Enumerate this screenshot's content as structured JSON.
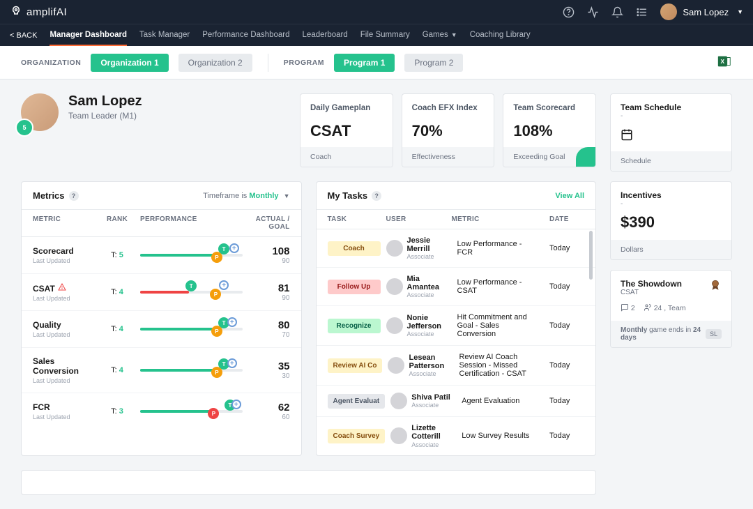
{
  "brand": "amplifAI",
  "user_top": "Sam Lopez",
  "nav": {
    "back": "< BACK",
    "items": [
      "Manager Dashboard",
      "Task Manager",
      "Performance Dashboard",
      "Leaderboard",
      "File Summary",
      "Games",
      "Coaching Library"
    ],
    "active": 0
  },
  "filters": {
    "org_label": "ORGANIZATION",
    "orgs": [
      "Organization 1",
      "Organization 2"
    ],
    "org_active": 0,
    "prog_label": "PROGRAM",
    "progs": [
      "Program 1",
      "Program 2"
    ],
    "prog_active": 0
  },
  "hero": {
    "name": "Sam Lopez",
    "role": "Team Leader (M1)",
    "badge": "5"
  },
  "kpis": [
    {
      "title": "Daily Gameplan",
      "value": "CSAT",
      "foot": "Coach"
    },
    {
      "title": "Coach EFX Index",
      "value": "70%",
      "foot": "Effectiveness"
    },
    {
      "title": "Team Scorecard",
      "value": "108%",
      "foot": "Exceeding Goal",
      "accent": true
    }
  ],
  "metrics": {
    "title": "Metrics",
    "timeframe_prefix": "Timeframe is ",
    "timeframe": "Monthly",
    "headers": [
      "METRIC",
      "RANK",
      "PERFORMANCE",
      "ACTUAL / GOAL"
    ],
    "rows": [
      {
        "name": "Scorecard",
        "sub": "Last Updated",
        "rank": "5",
        "actual": "108",
        "goal": "90",
        "warn": false,
        "t": 82,
        "p": 75,
        "plus": 92,
        "fill": 72,
        "color": "#25c28d",
        "p_red": false
      },
      {
        "name": "CSAT",
        "sub": "Last Updated",
        "rank": "4",
        "actual": "81",
        "goal": "90",
        "warn": true,
        "t": 50,
        "p": 74,
        "plus": 82,
        "fill": 48,
        "color": "#ef4444",
        "p_red": false
      },
      {
        "name": "Quality",
        "sub": "Last Updated",
        "rank": "4",
        "actual": "80",
        "goal": "70",
        "warn": false,
        "t": 82,
        "p": 75,
        "plus": 90,
        "fill": 72,
        "color": "#25c28d",
        "p_red": false
      },
      {
        "name": "Sales Conversion",
        "sub": "Last Updated",
        "rank": "4",
        "actual": "35",
        "goal": "30",
        "warn": false,
        "t": 82,
        "p": 75,
        "plus": 90,
        "fill": 72,
        "color": "#25c28d",
        "p_red": false
      },
      {
        "name": "FCR",
        "sub": "Last Updated",
        "rank": "3",
        "actual": "62",
        "goal": "60",
        "warn": false,
        "t": 88,
        "p": 72,
        "plus": 94,
        "fill": 70,
        "color": "#25c28d",
        "p_red": true
      }
    ]
  },
  "tasks": {
    "title": "My Tasks",
    "view_all": "View All",
    "headers": [
      "TASK",
      "USER",
      "METRIC",
      "DATE"
    ],
    "rows": [
      {
        "tag": "Coach",
        "cls": "y",
        "user": "Jessie Merrill",
        "role": "Associate",
        "metric": "Low Performance - FCR",
        "date": "Today"
      },
      {
        "tag": "Follow Up",
        "cls": "pk",
        "user": "Mia Amantea",
        "role": "Associate",
        "metric": "Low Performance - CSAT",
        "date": "Today"
      },
      {
        "tag": "Recognize",
        "cls": "gr",
        "user": "Nonie Jefferson",
        "role": "Associate",
        "metric": "Hit Commitment and Goal - Sales Conversion",
        "date": "Today"
      },
      {
        "tag": "Review AI Co",
        "cls": "y",
        "user": "Lesean Patterson",
        "role": "Associate",
        "metric": "Review AI Coach Session - Missed Certification - CSAT",
        "date": "Today"
      },
      {
        "tag": "Agent Evaluat",
        "cls": "gy",
        "user": "Shiva Patil",
        "role": "Associate",
        "metric": "Agent Evaluation",
        "date": "Today"
      },
      {
        "tag": "Coach Survey",
        "cls": "y",
        "user": "Lizette Cotterill",
        "role": "Associate",
        "metric": "Low Survey Results",
        "date": "Today"
      }
    ]
  },
  "side": {
    "schedule": {
      "title": "Team Schedule",
      "foot": "Schedule"
    },
    "incentives": {
      "title": "Incentives",
      "value": "$390",
      "foot": "Dollars"
    },
    "showdown": {
      "title": "The Showdown",
      "sub": "CSAT",
      "comments": "2",
      "players": "24 , Team",
      "foot_prefix": "Monthly ",
      "foot_mid": "game ends in ",
      "days": "24 days",
      "badge": "SL"
    }
  }
}
